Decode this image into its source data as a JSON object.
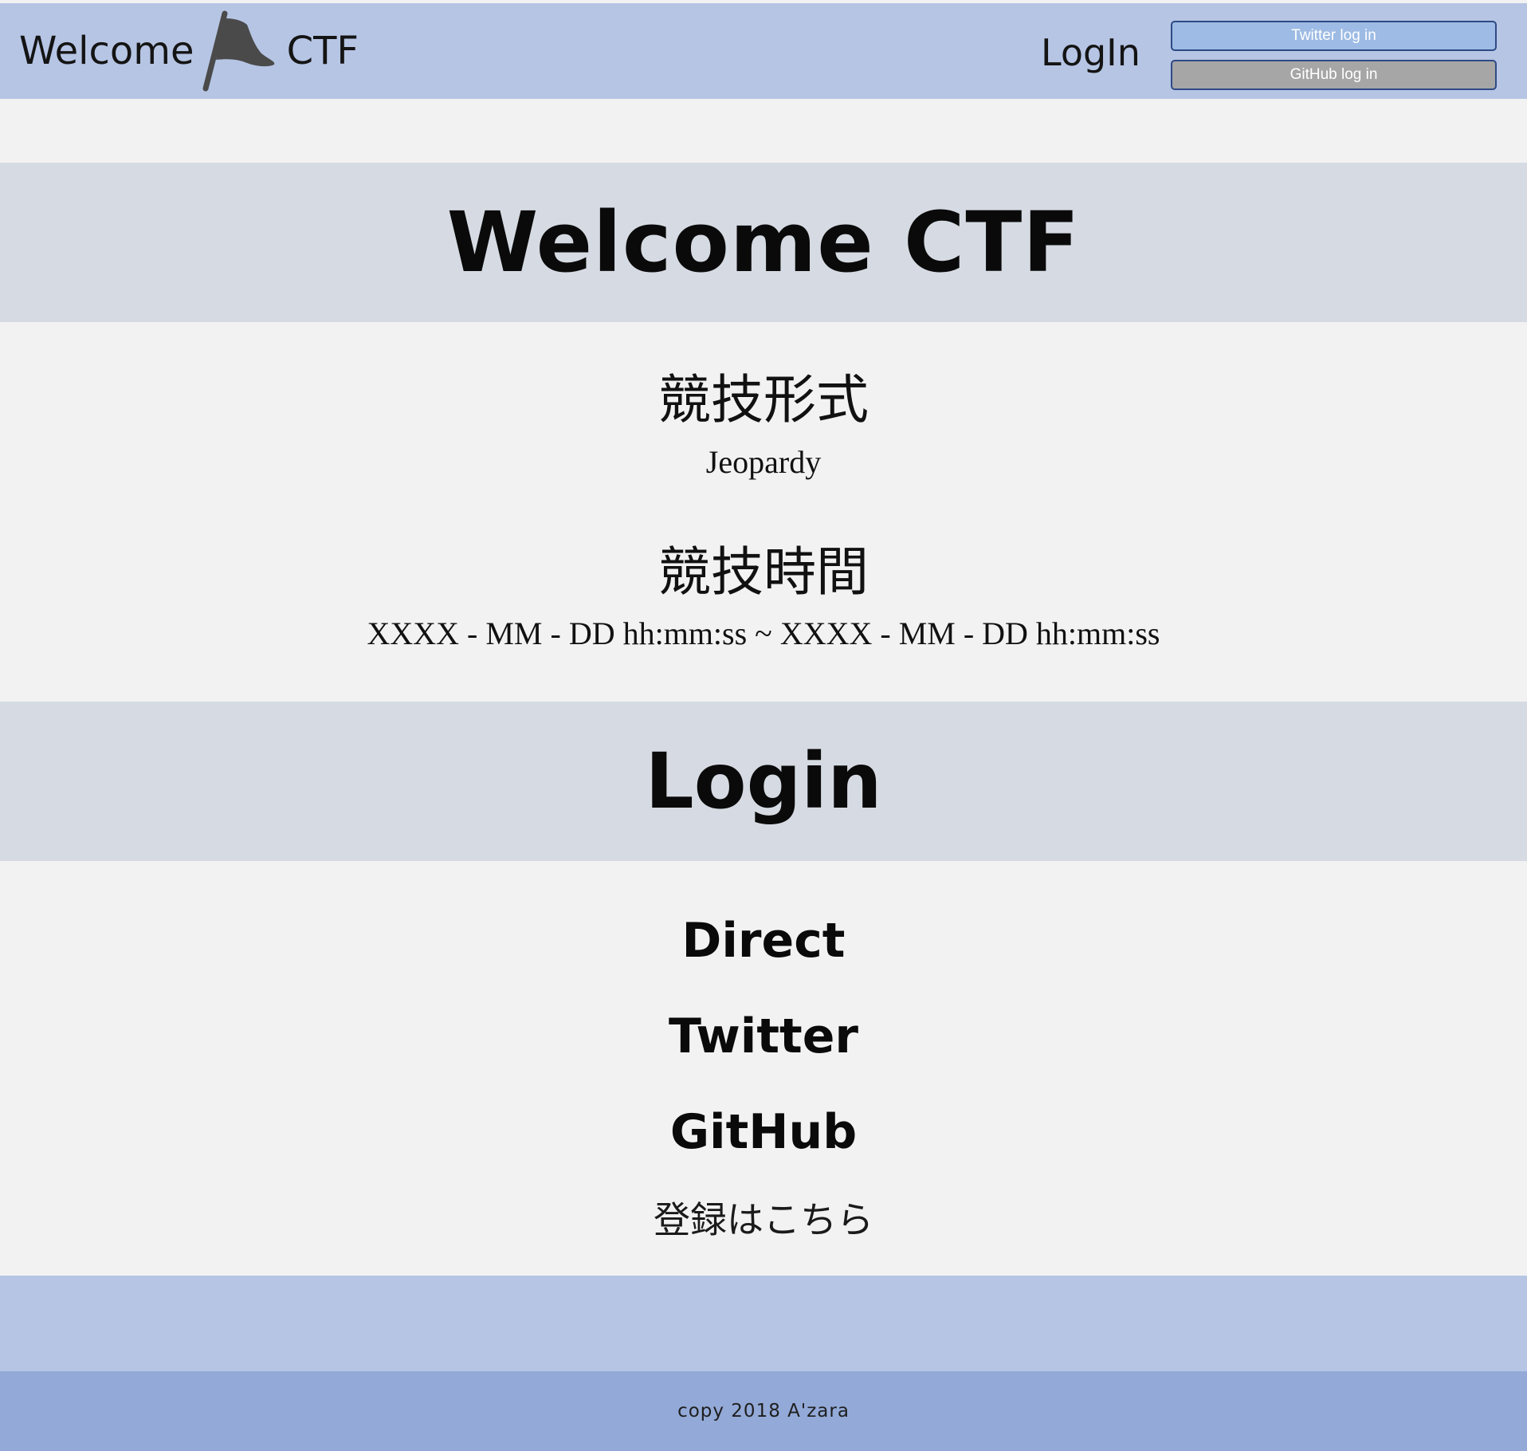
{
  "header": {
    "brand_left": "Welcome",
    "brand_right": "CTF",
    "login_label": "LogIn",
    "twitter_button": "Twitter log in",
    "github_button": "GitHub  log in",
    "flag_icon": "flag-icon"
  },
  "hero": {
    "title": "Welcome CTF"
  },
  "info": {
    "format_heading": "競技形式",
    "format_value": "Jeopardy",
    "time_heading": "競技時間",
    "time_value": "XXXX - MM - DD hh:mm:ss  ~  XXXX - MM - DD hh:mm:ss"
  },
  "login_section": {
    "title": "Login",
    "options": [
      "Direct",
      "Twitter",
      "GitHub"
    ],
    "register_link": "登録はこちら"
  },
  "footer": {
    "copyright": "copy 2018 A'zara"
  },
  "colors": {
    "header_bg": "#b6c5e4",
    "band_bg": "#d6dbe3",
    "page_bg": "#f2f2f2",
    "footer_lower_bg": "#93aad8",
    "twitter_button_bg": "#9dbbe4",
    "github_button_bg": "#a6a6a6"
  }
}
